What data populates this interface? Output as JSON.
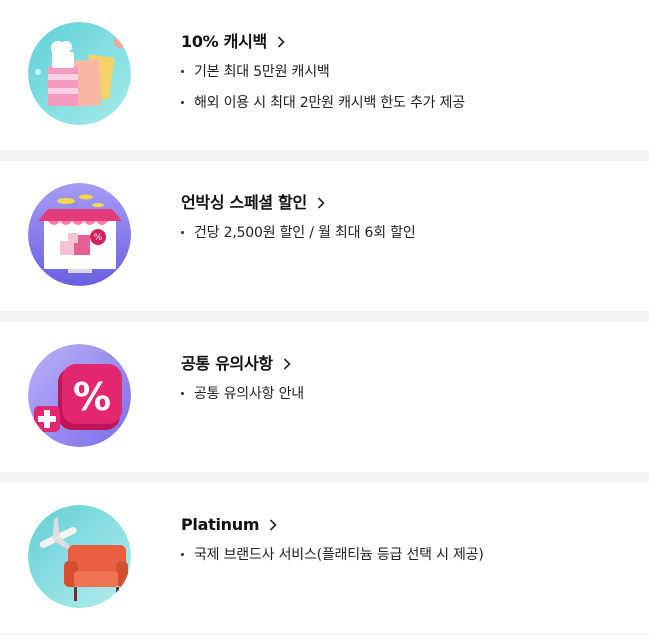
{
  "benefits": [
    {
      "title": "10% 캐시백",
      "icon": "shopping-bags-icon",
      "colors": [
        "#7fd8e0",
        "#f3a9c4"
      ],
      "bullets": [
        "기본 최대 5만원 캐시백",
        "해외 이용 시 최대 2만원 캐시백 한도 추가 제공"
      ]
    },
    {
      "title": "언박싱 스페셜 할인",
      "icon": "store-discount-icon",
      "colors": [
        "#8a80ee",
        "#e0306f"
      ],
      "bullets": [
        "건당 2,500원 할인 / 월 최대 6회 할인"
      ]
    },
    {
      "title": "공통 유의사항",
      "icon": "percent-plus-icon",
      "colors": [
        "#9a8ff2",
        "#d41f66"
      ],
      "bullets": [
        "공통 유의사항 안내"
      ]
    },
    {
      "title": "Platinum",
      "icon": "airplane-chair-icon",
      "colors": [
        "#7ed6dd",
        "#e8603f"
      ],
      "bullets": [
        "국제 브랜드사 서비스(플래티늄 등급 선택 시 제공)"
      ]
    }
  ]
}
